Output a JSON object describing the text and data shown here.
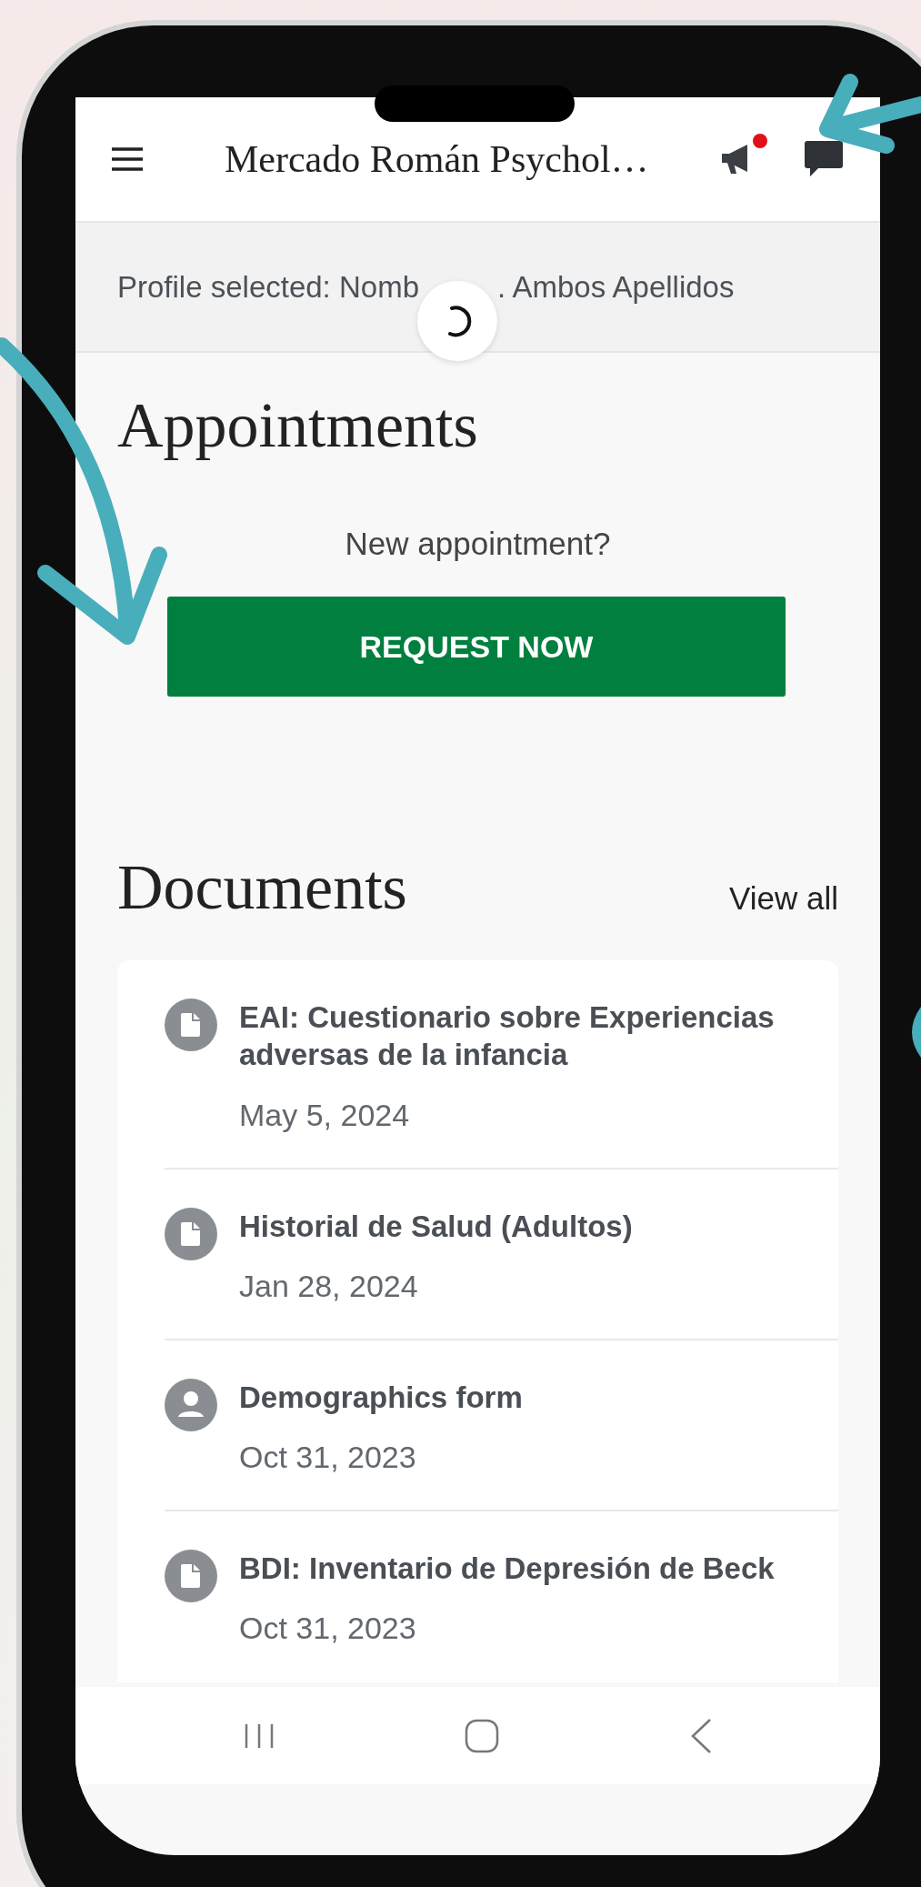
{
  "header": {
    "title": "Mercado Román Psychol…",
    "notification_dot": true
  },
  "profile_bar": {
    "text_before": "Profile selected: Nomb",
    "text_after": ". Ambos Apellidos"
  },
  "appointments": {
    "heading": "Appointments",
    "prompt": "New appointment?",
    "button": "REQUEST NOW"
  },
  "documents": {
    "heading": "Documents",
    "link": "View all",
    "items": [
      {
        "kind": "file",
        "title": "EAI: Cuestionario sobre Experiencias adversas de la infancia",
        "date": "May 5, 2024"
      },
      {
        "kind": "file",
        "title": "Historial de Salud (Adultos)",
        "date": "Jan 28, 2024"
      },
      {
        "kind": "person",
        "title": "Demographics form",
        "date": "Oct 31, 2023"
      },
      {
        "kind": "file",
        "title": "BDI: Inventario de Depresión de Beck",
        "date": "Oct 31, 2023"
      }
    ]
  }
}
